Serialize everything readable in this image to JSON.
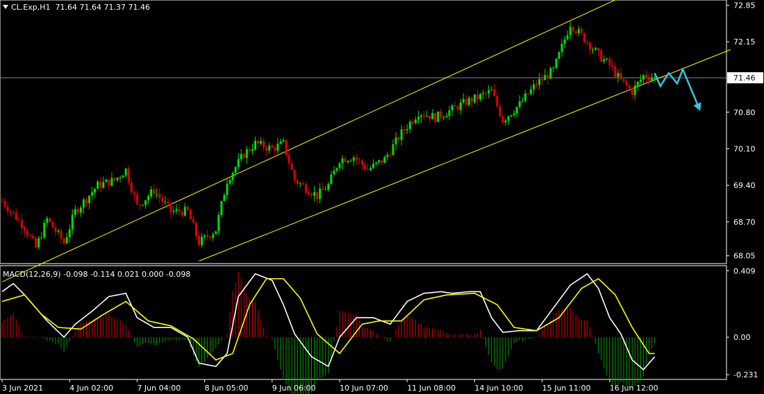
{
  "header": {
    "symbol": "CL.Exp,H1",
    "ohlc": "71.64 71.64 71.37 71.46",
    "macd_title": "MACD(12,26,9) -0.098 -0.114 0.021 0.000 -0.098"
  },
  "colors": {
    "background": "#000000",
    "bull": "#00e000",
    "bear": "#e00000",
    "channel": "#ffff00",
    "price_line": "#7a8aa0",
    "forecast": "#33c7e0",
    "macd_line": "#ffffff",
    "signal_line": "#ffff00",
    "hist_pos": "#e00000",
    "hist_neg": "#00a000",
    "axis": "#ffffff"
  },
  "chart_data": [
    {
      "type": "candlestick",
      "ylim": [
        67.9,
        72.95
      ],
      "y_ticks": [
        "72.85",
        "72.15",
        "71.46",
        "70.80",
        "70.10",
        "69.40",
        "68.70",
        "68.05"
      ],
      "current_price": "71.46",
      "x_ticks": [
        "3 Jun 2021",
        "4 Jun 02:00",
        "7 Jun 04:00",
        "8 Jun 05:00",
        "9 Jun 06:00",
        "10 Jun 07:00",
        "11 Jun 08:00",
        "14 Jun 10:00",
        "15 Jun 11:00",
        "16 Jun 12:00"
      ],
      "bar_count": 233,
      "x_tick_bars": [
        0,
        24,
        48,
        72,
        96,
        120,
        144,
        168,
        192,
        216
      ],
      "close_anchors": [
        [
          0,
          69.1
        ],
        [
          8,
          68.6
        ],
        [
          12,
          68.2
        ],
        [
          16,
          68.75
        ],
        [
          22,
          68.3
        ],
        [
          26,
          68.9
        ],
        [
          34,
          69.4
        ],
        [
          40,
          69.5
        ],
        [
          44,
          69.7
        ],
        [
          48,
          69.0
        ],
        [
          54,
          69.3
        ],
        [
          60,
          68.9
        ],
        [
          66,
          68.9
        ],
        [
          70,
          68.3
        ],
        [
          76,
          68.55
        ],
        [
          80,
          69.5
        ],
        [
          86,
          70.0
        ],
        [
          90,
          70.2
        ],
        [
          96,
          70.1
        ],
        [
          100,
          70.2
        ],
        [
          104,
          69.5
        ],
        [
          108,
          69.35
        ],
        [
          112,
          69.2
        ],
        [
          116,
          69.4
        ],
        [
          120,
          69.9
        ],
        [
          125,
          69.95
        ],
        [
          130,
          69.7
        ],
        [
          136,
          69.9
        ],
        [
          142,
          70.4
        ],
        [
          148,
          70.8
        ],
        [
          154,
          70.7
        ],
        [
          160,
          70.85
        ],
        [
          165,
          71.0
        ],
        [
          170,
          71.1
        ],
        [
          174,
          71.2
        ],
        [
          178,
          70.65
        ],
        [
          184,
          70.95
        ],
        [
          190,
          71.35
        ],
        [
          196,
          71.6
        ],
        [
          202,
          72.5
        ],
        [
          208,
          72.15
        ],
        [
          212,
          71.9
        ],
        [
          216,
          71.7
        ],
        [
          220,
          71.4
        ],
        [
          224,
          71.2
        ],
        [
          228,
          71.5
        ],
        [
          232,
          71.46
        ]
      ],
      "channel_upper": [
        [
          0,
          67.55
        ],
        [
          224,
          73.1
        ]
      ],
      "channel_lower": [
        [
          70,
          67.95
        ],
        [
          259,
          72.0
        ]
      ],
      "forecast_path": [
        [
          232,
          71.55
        ],
        [
          234,
          71.3
        ],
        [
          237,
          71.55
        ],
        [
          240,
          71.35
        ],
        [
          242,
          71.62
        ],
        [
          248,
          70.85
        ]
      ]
    },
    {
      "type": "line+bar",
      "name": "MACD(12,26,9)",
      "ylim": [
        -0.26,
        0.44
      ],
      "y_ticks": [
        "0.409",
        "0.00",
        "-0.231"
      ],
      "macd_anchors": [
        [
          0,
          0.28
        ],
        [
          4,
          0.33
        ],
        [
          8,
          0.26
        ],
        [
          12,
          0.18
        ],
        [
          16,
          0.1
        ],
        [
          22,
          0.0
        ],
        [
          26,
          0.08
        ],
        [
          32,
          0.16
        ],
        [
          38,
          0.25
        ],
        [
          44,
          0.27
        ],
        [
          48,
          0.12
        ],
        [
          54,
          0.06
        ],
        [
          60,
          0.06
        ],
        [
          66,
          0.0
        ],
        [
          70,
          -0.16
        ],
        [
          76,
          -0.18
        ],
        [
          80,
          -0.1
        ],
        [
          84,
          0.25
        ],
        [
          90,
          0.39
        ],
        [
          96,
          0.35
        ],
        [
          100,
          0.2
        ],
        [
          104,
          0.02
        ],
        [
          110,
          -0.12
        ],
        [
          116,
          -0.18
        ],
        [
          120,
          0.0
        ],
        [
          126,
          0.12
        ],
        [
          132,
          0.12
        ],
        [
          138,
          0.08
        ],
        [
          144,
          0.22
        ],
        [
          150,
          0.27
        ],
        [
          156,
          0.28
        ],
        [
          160,
          0.27
        ],
        [
          166,
          0.28
        ],
        [
          170,
          0.28
        ],
        [
          174,
          0.12
        ],
        [
          178,
          0.03
        ],
        [
          184,
          0.04
        ],
        [
          190,
          0.04
        ],
        [
          196,
          0.18
        ],
        [
          202,
          0.32
        ],
        [
          208,
          0.39
        ],
        [
          212,
          0.3
        ],
        [
          216,
          0.12
        ],
        [
          220,
          0.02
        ],
        [
          224,
          -0.14
        ],
        [
          228,
          -0.2
        ],
        [
          232,
          -0.12
        ]
      ],
      "signal_anchors": [
        [
          0,
          0.22
        ],
        [
          8,
          0.26
        ],
        [
          14,
          0.14
        ],
        [
          20,
          0.06
        ],
        [
          28,
          0.05
        ],
        [
          36,
          0.14
        ],
        [
          44,
          0.22
        ],
        [
          52,
          0.1
        ],
        [
          60,
          0.07
        ],
        [
          68,
          -0.01
        ],
        [
          76,
          -0.14
        ],
        [
          82,
          -0.1
        ],
        [
          88,
          0.2
        ],
        [
          94,
          0.36
        ],
        [
          100,
          0.36
        ],
        [
          106,
          0.24
        ],
        [
          112,
          0.02
        ],
        [
          120,
          -0.1
        ],
        [
          128,
          0.08
        ],
        [
          134,
          0.1
        ],
        [
          142,
          0.1
        ],
        [
          150,
          0.23
        ],
        [
          158,
          0.26
        ],
        [
          168,
          0.27
        ],
        [
          176,
          0.2
        ],
        [
          182,
          0.06
        ],
        [
          190,
          0.04
        ],
        [
          198,
          0.12
        ],
        [
          206,
          0.3
        ],
        [
          212,
          0.36
        ],
        [
          218,
          0.26
        ],
        [
          224,
          0.06
        ],
        [
          230,
          -0.1
        ],
        [
          232,
          -0.1
        ]
      ]
    }
  ]
}
